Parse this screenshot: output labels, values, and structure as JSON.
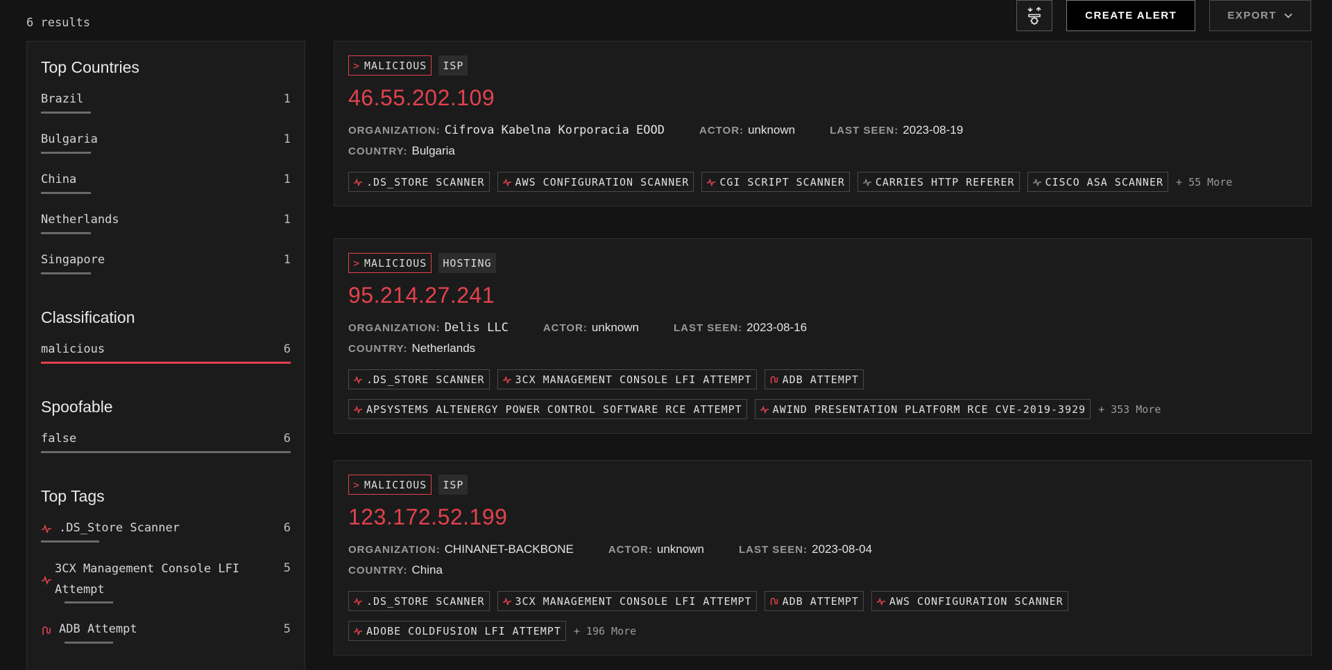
{
  "header": {
    "results_count": "6 results",
    "create_alert_label": "CREATE ALERT",
    "export_label": "EXPORT"
  },
  "sidebar": {
    "countries": {
      "title": "Top Countries",
      "items": [
        {
          "label": "Brazil",
          "count": "1"
        },
        {
          "label": "Bulgaria",
          "count": "1"
        },
        {
          "label": "China",
          "count": "1"
        },
        {
          "label": "Netherlands",
          "count": "1"
        },
        {
          "label": "Singapore",
          "count": "1"
        }
      ]
    },
    "classification": {
      "title": "Classification",
      "items": [
        {
          "label": "malicious",
          "count": "6"
        }
      ]
    },
    "spoofable": {
      "title": "Spoofable",
      "items": [
        {
          "label": "false",
          "count": "6"
        }
      ]
    },
    "tags": {
      "title": "Top Tags",
      "items": [
        {
          "label": ".DS_Store Scanner",
          "count": "6",
          "icon": "activity-icon"
        },
        {
          "label": "3CX Management Console LFI Attempt",
          "count": "5",
          "icon": "activity-icon"
        },
        {
          "label": "ADB Attempt",
          "count": "5",
          "icon": "worm-icon"
        }
      ]
    }
  },
  "results": [
    {
      "classification": "MALICIOUS",
      "type": "ISP",
      "ip": "46.55.202.109",
      "org_key": "ORGANIZATION:",
      "org": "Cifrova Kabelna Korporacia EOOD",
      "actor_key": "ACTOR:",
      "actor": "unknown",
      "seen_key": "LAST SEEN:",
      "seen": "2023-08-19",
      "country_key": "COUNTRY:",
      "country": "Bulgaria",
      "tags": [
        {
          "label": ".DS_STORE SCANNER",
          "icon": "activity-icon",
          "color": "#e2424d"
        },
        {
          "label": "AWS CONFIGURATION SCANNER",
          "icon": "activity-icon",
          "color": "#e2424d"
        },
        {
          "label": "CGI SCRIPT SCANNER",
          "icon": "activity-icon",
          "color": "#e2424d"
        },
        {
          "label": "CARRIES HTTP REFERER",
          "icon": "activity-icon",
          "color": "#8a8a8a"
        },
        {
          "label": "CISCO ASA SCANNER",
          "icon": "activity-icon",
          "color": "#8a8a8a"
        }
      ],
      "more": "+ 55 More"
    },
    {
      "classification": "MALICIOUS",
      "type": "HOSTING",
      "ip": "95.214.27.241",
      "org_key": "ORGANIZATION:",
      "org": "Delis LLC",
      "actor_key": "ACTOR:",
      "actor": "unknown",
      "seen_key": "LAST SEEN:",
      "seen": "2023-08-16",
      "country_key": "COUNTRY:",
      "country": "Netherlands",
      "tags": [
        {
          "label": ".DS_STORE SCANNER",
          "icon": "activity-icon",
          "color": "#e2424d"
        },
        {
          "label": "3CX MANAGEMENT CONSOLE LFI ATTEMPT",
          "icon": "activity-icon",
          "color": "#e2424d"
        },
        {
          "label": "ADB ATTEMPT",
          "icon": "worm-icon",
          "color": "#e2424d"
        },
        {
          "label": "APSYSTEMS ALTENERGY POWER CONTROL SOFTWARE RCE ATTEMPT",
          "icon": "activity-icon",
          "color": "#e2424d"
        },
        {
          "label": "AWIND PRESENTATION PLATFORM RCE CVE-2019-3929",
          "icon": "activity-icon",
          "color": "#e2424d"
        }
      ],
      "more": "+ 353 More"
    },
    {
      "classification": "MALICIOUS",
      "type": "ISP",
      "ip": "123.172.52.199",
      "org_key": "ORGANIZATION:",
      "org": "CHINANET-BACKBONE",
      "actor_key": "ACTOR:",
      "actor": "unknown",
      "seen_key": "LAST SEEN:",
      "seen": "2023-08-04",
      "country_key": "COUNTRY:",
      "country": "China",
      "tags": [
        {
          "label": ".DS_STORE SCANNER",
          "icon": "activity-icon",
          "color": "#e2424d"
        },
        {
          "label": "3CX MANAGEMENT CONSOLE LFI ATTEMPT",
          "icon": "activity-icon",
          "color": "#e2424d"
        },
        {
          "label": "ADB ATTEMPT",
          "icon": "worm-icon",
          "color": "#e2424d"
        },
        {
          "label": "AWS CONFIGURATION SCANNER",
          "icon": "activity-icon",
          "color": "#e2424d"
        },
        {
          "label": "ADOBE COLDFUSION LFI ATTEMPT",
          "icon": "activity-icon",
          "color": "#e2424d"
        }
      ],
      "more": "+ 196 More"
    }
  ],
  "colors": {
    "accent": "#e2424d",
    "background": "#141414",
    "panel": "#1b1b1b"
  }
}
